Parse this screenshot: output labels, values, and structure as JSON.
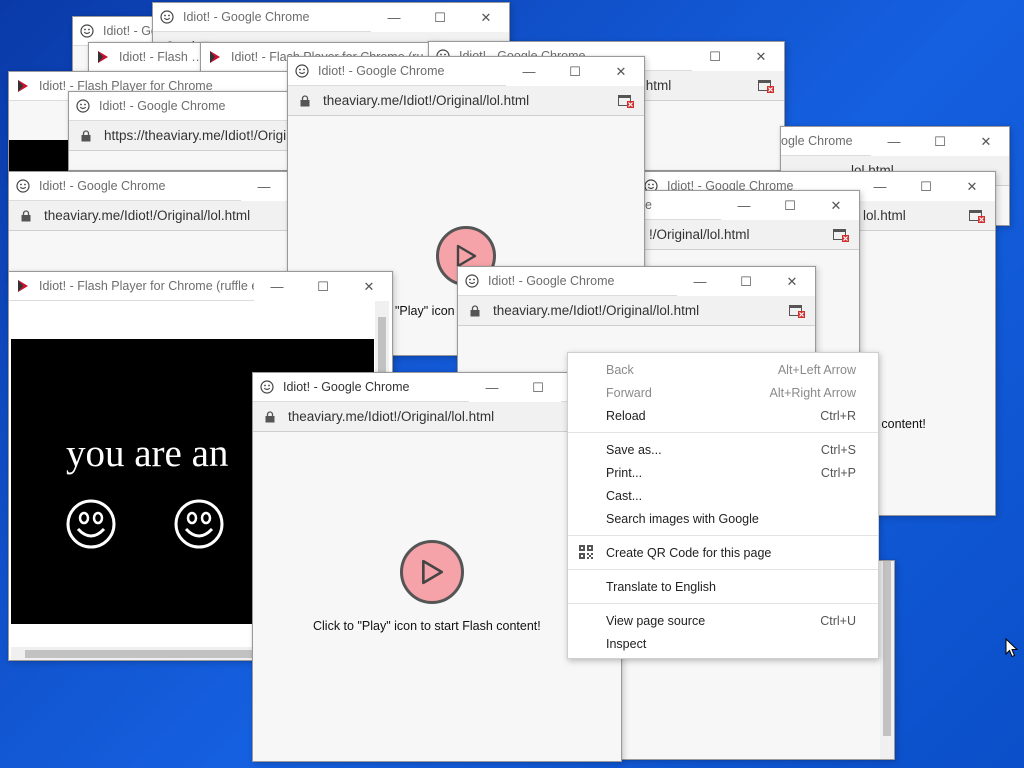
{
  "title_chrome": "Idiot! - Google Chrome",
  "title_flash": "Idiot! - Flash Player for Chrome (ruffle e...",
  "title_flash_short": "Idiot! - Flash Player for Chrome (ruffle",
  "title_flash_crop": "Idiot! - Flash Player for Chrome",
  "title_chrome_crop1": "Idiot! - Go",
  "title_chrome_crop2": "ogle Chrome",
  "title_chrome_crop3": "Idiot! - Google Chrome",
  "url_short": "theaviary.me/Idiot!/Original/lol.html",
  "url_full": "https://theaviary.me/Idiot!/Original/lol.html",
  "url_crop1": "l.html",
  "url_crop2": "/Original/lol.html",
  "url_crop3": "!/Original/lol.html",
  "url_crop4": "lol.html",
  "url_crop5": "the",
  "flash_message": "Click to \"Play\" icon to start Flash content!",
  "flash_message_crop": "\"Play\" icon",
  "flash_message_crop2": "n content!",
  "idiot_text": "you are an",
  "context_menu": {
    "back": {
      "label": "Back",
      "shortcut": "Alt+Left Arrow"
    },
    "forward": {
      "label": "Forward",
      "shortcut": "Alt+Right Arrow"
    },
    "reload": {
      "label": "Reload",
      "shortcut": "Ctrl+R"
    },
    "save_as": {
      "label": "Save as...",
      "shortcut": "Ctrl+S"
    },
    "print": {
      "label": "Print...",
      "shortcut": "Ctrl+P"
    },
    "cast": {
      "label": "Cast..."
    },
    "search_images": {
      "label": "Search images with Google"
    },
    "qr_code": {
      "label": "Create QR Code for this page"
    },
    "translate": {
      "label": "Translate to English"
    },
    "view_source": {
      "label": "View page source",
      "shortcut": "Ctrl+U"
    },
    "inspect": {
      "label": "Inspect"
    }
  },
  "colors": {
    "play_fill": "#f5a3a8",
    "desktop": "#1560e0",
    "flash_logo": "#c8102e"
  }
}
